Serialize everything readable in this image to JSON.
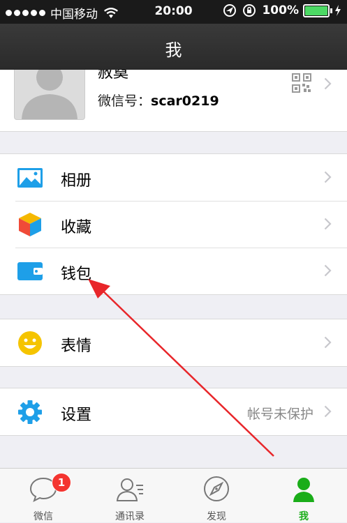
{
  "status_bar": {
    "carrier": "中国移动",
    "time": "20:00",
    "battery": "100%",
    "battery_level": 1.0
  },
  "nav": {
    "title": "我"
  },
  "profile": {
    "nickname": "赦奠",
    "wechat_id_label": "微信号：",
    "wechat_id": "scar0219"
  },
  "menu": {
    "album": {
      "label": "相册",
      "icon": "photo-album-icon"
    },
    "favorites": {
      "label": "收藏",
      "icon": "favorites-cube-icon"
    },
    "wallet": {
      "label": "钱包",
      "icon": "wallet-icon"
    },
    "stickers": {
      "label": "表情",
      "icon": "smiley-icon"
    },
    "settings": {
      "label": "设置",
      "value": "帐号未保护",
      "icon": "gear-icon"
    }
  },
  "tabs": [
    {
      "label": "微信",
      "badge": "1",
      "icon": "chat-bubble-icon"
    },
    {
      "label": "通讯录",
      "icon": "contacts-icon"
    },
    {
      "label": "发现",
      "icon": "compass-icon"
    },
    {
      "label": "我",
      "icon": "person-icon",
      "active": true
    }
  ],
  "colors": {
    "accent_green": "#1aad19",
    "badge_red": "#f43530",
    "annotation_arrow": "#e8262a",
    "icon_blue": "#1e9fe8"
  }
}
